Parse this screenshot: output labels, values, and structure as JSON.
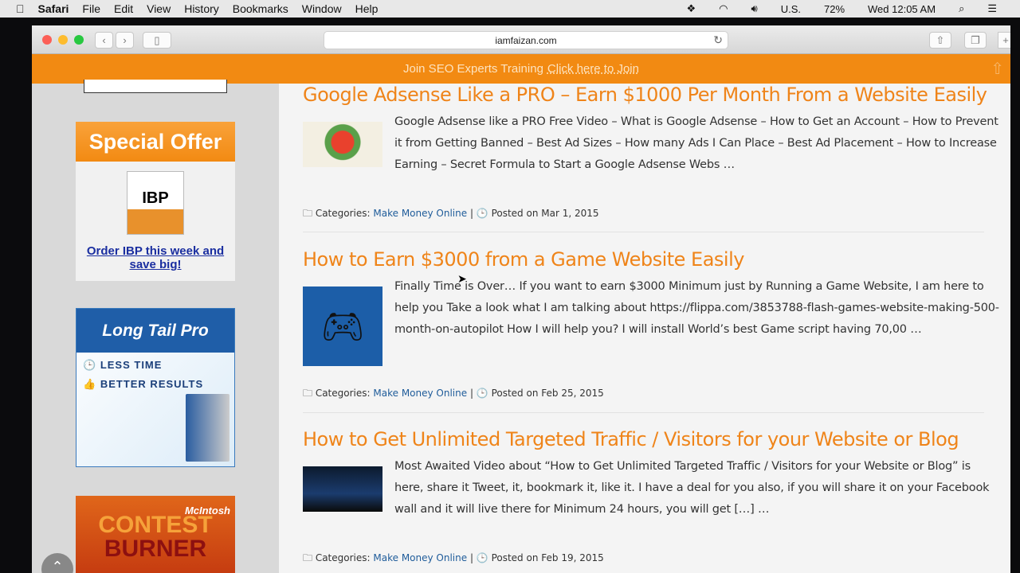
{
  "menubar": {
    "app": "Safari",
    "items": [
      "File",
      "Edit",
      "View",
      "History",
      "Bookmarks",
      "Window",
      "Help"
    ],
    "status": {
      "locale": "U.S.",
      "battery": "72%",
      "clock": "Wed 12:05 AM"
    }
  },
  "browser": {
    "url": "iamfaizan.com"
  },
  "banner": {
    "text": "Join SEO Experts Training",
    "link": "Click here to Join"
  },
  "sidebar": {
    "ad1": {
      "header": "Special Offer",
      "product": "IBP",
      "link": "Order IBP this week and save big!"
    },
    "ad2": {
      "header": "Long Tail Pro",
      "line1": "LESS TIME",
      "line2": "BETTER RESULTS"
    },
    "ad3": {
      "brand": "McIntosh",
      "title1": "CONTEST",
      "title2": "BURNER"
    }
  },
  "posts": [
    {
      "title": "Google Adsense Like a PRO – Earn $1000 Per Month From a Website Easily",
      "excerpt": "Google Adsense like a PRO Free Video – What is Google Adsense – How to Get an Account – How to Prevent it from Getting Banned – Best Ad Sizes – How many Ads I Can Place – Best Ad Placement – How to Increase Earning – Secret Formula to Start a Google Adsense Webs …",
      "categories_label": "Categories:",
      "category": "Make Money Online",
      "posted_label": "Posted on",
      "date": "Mar 1, 2015"
    },
    {
      "title": "How to Earn $3000 from a Game Website Easily",
      "excerpt": "Finally Time is Over… If you want to earn $3000 Minimum just by Running a Game Website, I am here to help you Take a look what I am talking about https://flippa.com/3853788-flash-games-website-making-500-month-on-autopilot How I will help you? I will install World’s best Game script  having 70,00 …",
      "categories_label": "Categories:",
      "category": "Make Money Online",
      "posted_label": "Posted on",
      "date": "Feb 25, 2015"
    },
    {
      "title": "How to Get Unlimited Targeted Traffic / Visitors for your Website or Blog",
      "excerpt": "Most Awaited Video about “How to Get Unlimited Targeted Traffic / Visitors for your Website or Blog” is here, share it Tweet, it, bookmark it, like it. I have a deal for you also, if you will share it on your Facebook wall and it will live there for Minimum 24 hours, you will get […] …",
      "categories_label": "Categories:",
      "category": "Make Money Online",
      "posted_label": "Posted on",
      "date": "Feb 19, 2015"
    }
  ]
}
